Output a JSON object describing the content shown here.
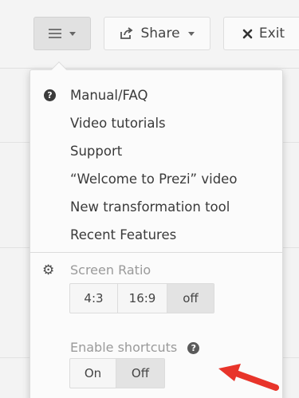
{
  "toolbar": {
    "menu_icon": "hamburger-icon",
    "share_label": "Share",
    "exit_label": "Exit"
  },
  "menu": {
    "items": [
      {
        "label": "Manual/FAQ",
        "icon": "help-icon"
      },
      {
        "label": "Video tutorials"
      },
      {
        "label": "Support"
      },
      {
        "label": "“Welcome to Prezi” video"
      },
      {
        "label": "New transformation tool"
      },
      {
        "label": "Recent Features"
      }
    ],
    "help_glyph": "?"
  },
  "screen_ratio": {
    "label": "Screen Ratio",
    "icon": "gear-icon",
    "options": [
      "4:3",
      "16:9",
      "off"
    ],
    "selected": "off"
  },
  "shortcuts": {
    "label": "Enable shortcuts",
    "help_glyph": "?",
    "options": [
      "On",
      "Off"
    ],
    "selected": "Off"
  },
  "colors": {
    "annotation_arrow": "#e8342a",
    "active_segment": "#e3e3e3"
  }
}
